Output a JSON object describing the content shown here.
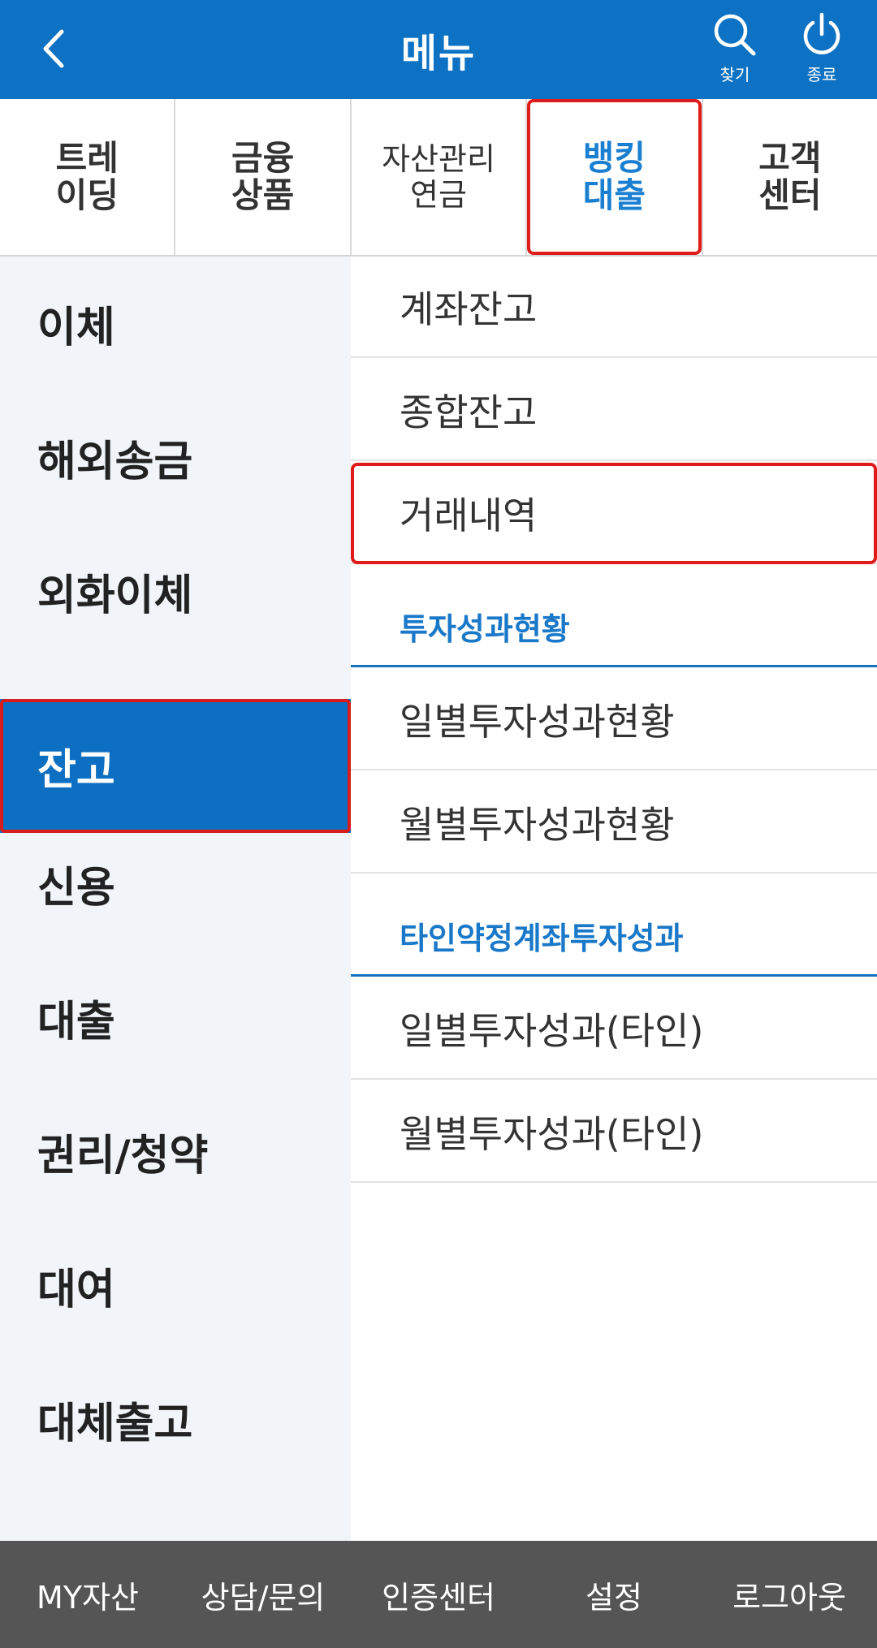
{
  "header": {
    "title": "메뉴",
    "search_label": "찾기",
    "power_label": "종료"
  },
  "tabs": [
    {
      "line1": "트레",
      "line2": "이딩"
    },
    {
      "line1": "금융",
      "line2": "상품"
    },
    {
      "line1": "자산관리",
      "line2": "연금"
    },
    {
      "line1": "뱅킹",
      "line2": "대출"
    },
    {
      "line1": "고객",
      "line2": "센터"
    }
  ],
  "left_nav": {
    "items": [
      {
        "label": "이체"
      },
      {
        "label": "해외송금"
      },
      {
        "label": "외화이체"
      },
      {
        "label": "잔고"
      },
      {
        "label": "신용"
      },
      {
        "label": "대출"
      },
      {
        "label": "권리/청약"
      },
      {
        "label": "대여"
      },
      {
        "label": "대체출고"
      }
    ]
  },
  "sub_menu": {
    "balance": [
      "계좌잔고",
      "종합잔고",
      "거래내역"
    ],
    "section1_title": "투자성과현황",
    "section1_items": [
      "일별투자성과현황",
      "월별투자성과현황"
    ],
    "section2_title": "타인약정계좌투자성과",
    "section2_items": [
      "일별투자성과(타인)",
      "월별투자성과(타인)"
    ]
  },
  "bottom_bar": [
    "MY자산",
    "상담/문의",
    "인증센터",
    "설정",
    "로그아웃"
  ],
  "colors": {
    "header_bg": "#0d72c3",
    "active_nav_bg": "#0d6fc1",
    "highlight_border": "#e01b1b",
    "section_title": "#1a78c9",
    "bottom_bar_bg": "#555555"
  }
}
